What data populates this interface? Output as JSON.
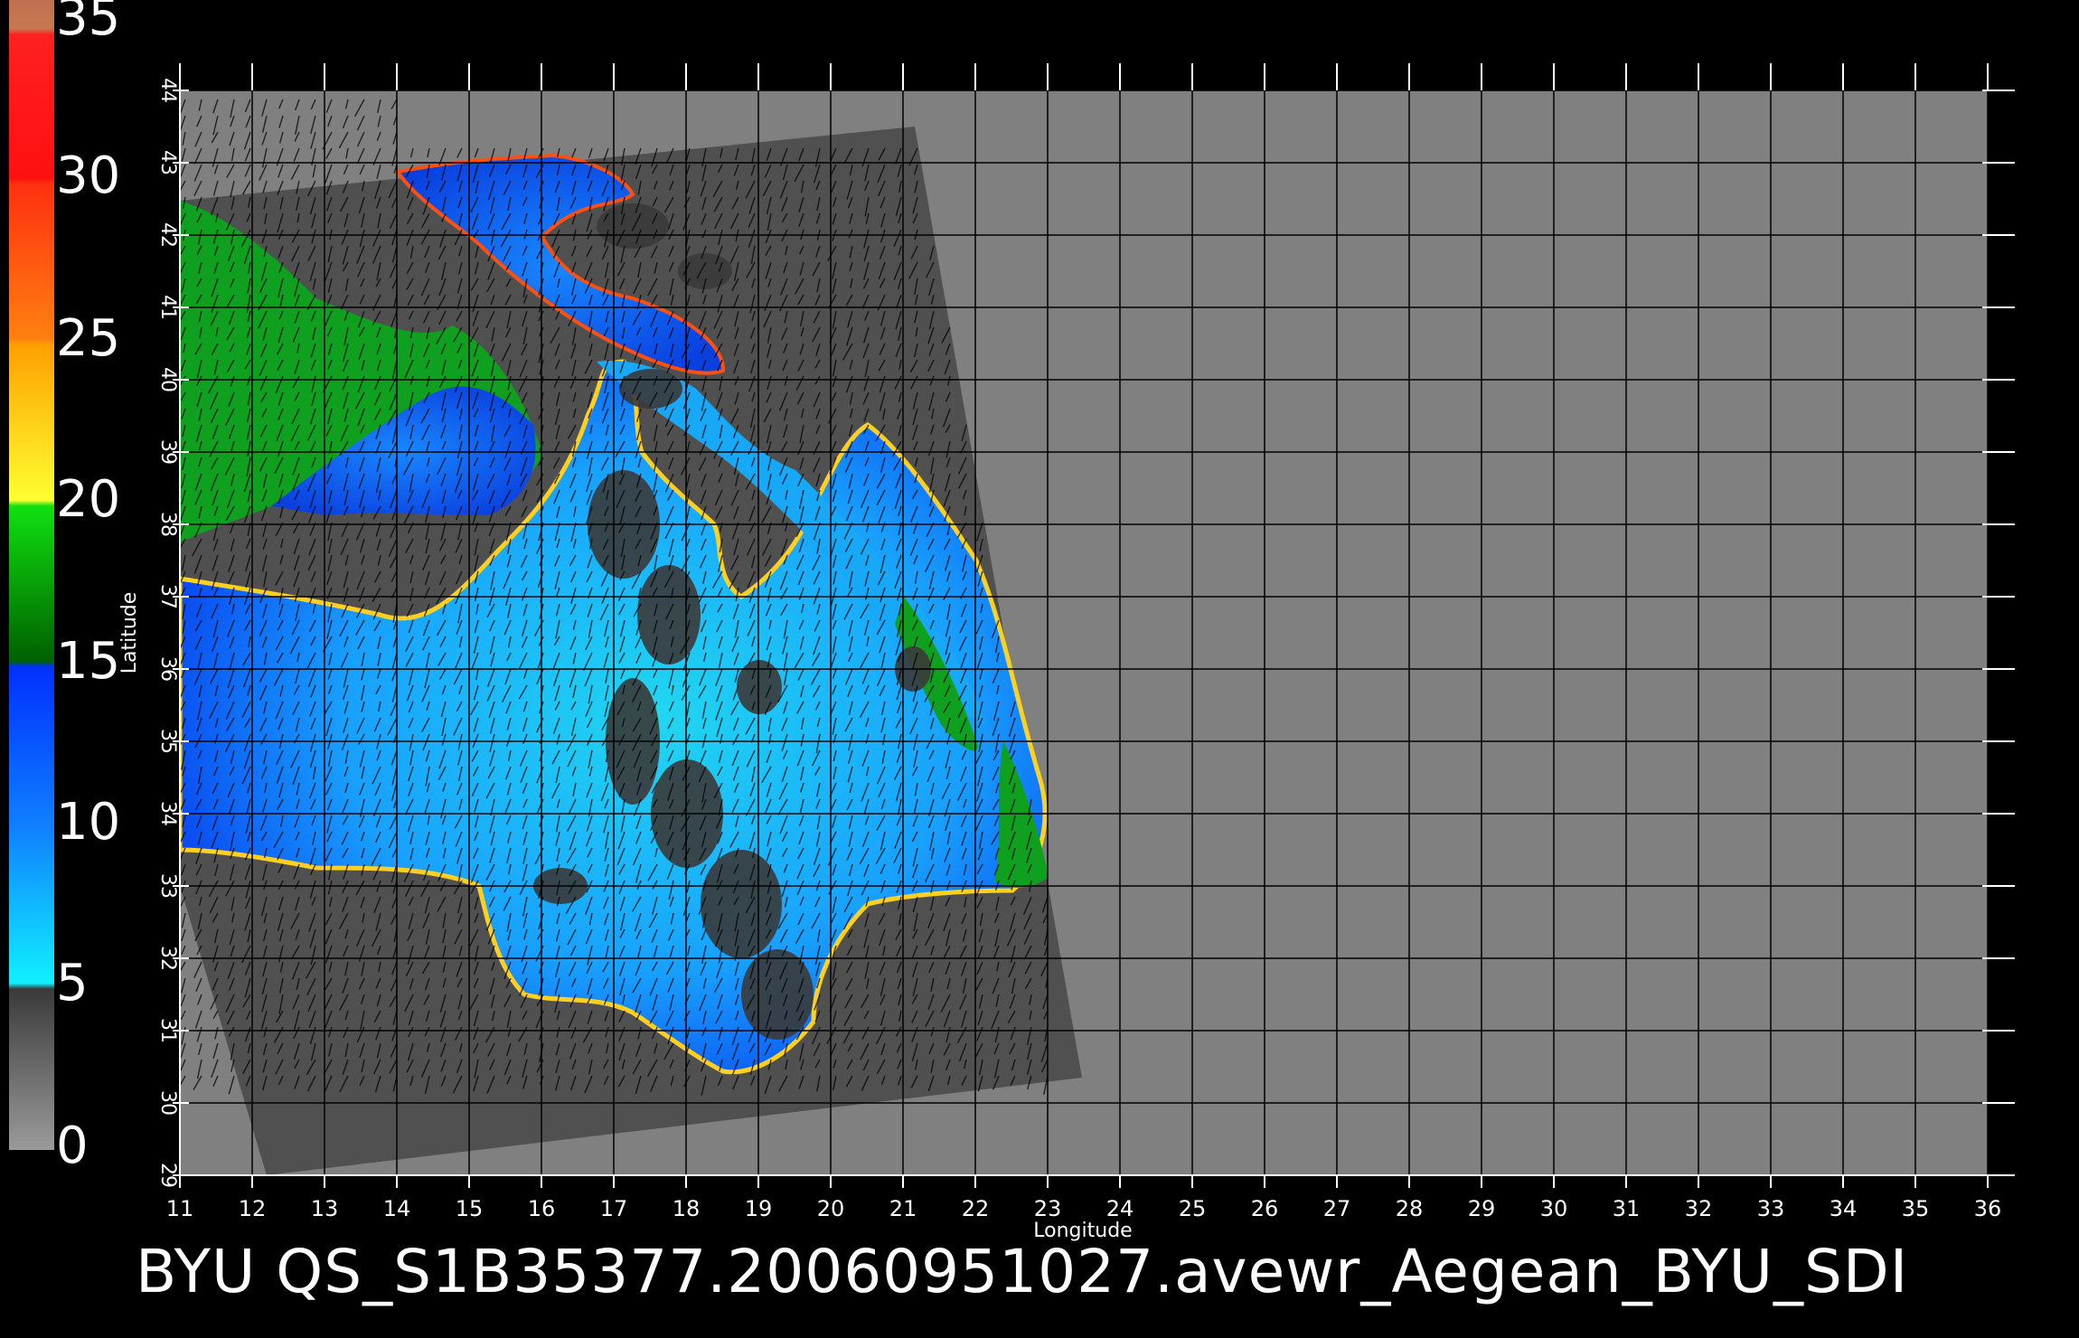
{
  "caption": "BYU  QS_S1B35377.20060951027.avewr_Aegean_BYU_SDI",
  "axes": {
    "xlabel": "Longitude",
    "ylabel": "Latitude",
    "x_ticks": [
      "11",
      "12",
      "13",
      "14",
      "15",
      "16",
      "17",
      "18",
      "19",
      "20",
      "21",
      "22",
      "23",
      "24",
      "25",
      "26",
      "27",
      "28",
      "29",
      "30",
      "31",
      "32",
      "33",
      "34",
      "35",
      "36"
    ],
    "y_ticks": [
      "29",
      "30",
      "31",
      "32",
      "33",
      "34",
      "35",
      "36",
      "37",
      "38",
      "39",
      "40",
      "41",
      "42",
      "43",
      "44"
    ]
  },
  "colorbar": {
    "labels": [
      "35",
      "30",
      "25",
      "20",
      "15",
      "10",
      "5",
      "0"
    ],
    "colors": {
      "top": "#c87850",
      "red": "#ff2010",
      "orange": "#ff7010",
      "yellow": "#ffe020",
      "green": "#10b010",
      "blue": "#1040ff",
      "cyan": "#10e0ff",
      "gray": "#505050"
    }
  },
  "colors": {
    "background": "#000000",
    "land": "#808080",
    "swath": "#505050",
    "sea_low": "#20d8f0",
    "sea_mid": "#1060ff",
    "sea_high": "#10a020",
    "grid": "#000000"
  }
}
